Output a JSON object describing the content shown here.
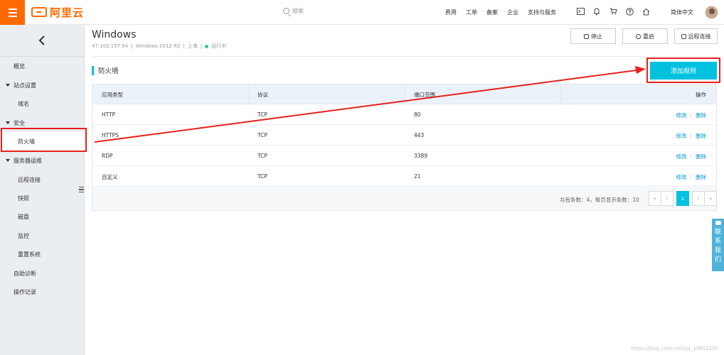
{
  "colors": {
    "brand": "#ff6a00",
    "accent": "#00c1de",
    "link": "#0099cc",
    "status_ok": "#2ecc71",
    "annotation": "#e8211b"
  },
  "topbar": {
    "logo_text": "阿里云",
    "search_placeholder": "搜索",
    "nav": [
      "费用",
      "工单",
      "备案",
      "企业",
      "支持与服务"
    ],
    "icons": [
      "terminal-icon",
      "bell-icon",
      "cart-icon",
      "help-icon",
      "home-icon"
    ],
    "language": "简体中文"
  },
  "sidebar": {
    "items": [
      {
        "label": "概览",
        "kind": "top"
      },
      {
        "label": "站点设置",
        "kind": "group"
      },
      {
        "label": "域名",
        "kind": "sub"
      },
      {
        "label": "安全",
        "kind": "group"
      },
      {
        "label": "防火墙",
        "kind": "sub",
        "active": true
      },
      {
        "label": "服务器运维",
        "kind": "group"
      },
      {
        "label": "远程连接",
        "kind": "sub"
      },
      {
        "label": "快照",
        "kind": "sub"
      },
      {
        "label": "磁盘",
        "kind": "sub"
      },
      {
        "label": "监控",
        "kind": "sub"
      },
      {
        "label": "重置系统",
        "kind": "sub"
      },
      {
        "label": "自助诊断",
        "kind": "top"
      },
      {
        "label": "操作记录",
        "kind": "top"
      }
    ]
  },
  "instance": {
    "name": "Windows",
    "ip": "47.102.157.94",
    "os": "Windows 2012 R2",
    "region": "上海",
    "status": "运行中",
    "sep": "|"
  },
  "actions": {
    "stop": "停止",
    "restart": "重启",
    "remote": "远程连接"
  },
  "firewall": {
    "title": "防火墙",
    "add_rule": "添加规则",
    "columns": [
      "应用类型",
      "协议",
      "端口范围",
      "操作"
    ],
    "rows": [
      {
        "app": "HTTP",
        "protocol": "TCP",
        "port": "80"
      },
      {
        "app": "HTTPS",
        "protocol": "TCP",
        "port": "443"
      },
      {
        "app": "RDP",
        "protocol": "TCP",
        "port": "3389"
      },
      {
        "app": "自定义",
        "protocol": "TCP",
        "port": "21"
      }
    ],
    "op_edit": "修改",
    "op_sep": "|",
    "op_delete": "删除",
    "pager_text": "共有条数：4，每页显示条数：10",
    "pager": {
      "first": "«",
      "prev": "‹",
      "current": "1",
      "next": "›",
      "last": "»"
    }
  },
  "contact": {
    "label": "联系我们"
  },
  "watermark": "https://blog.csdn.net/qq_19652297"
}
